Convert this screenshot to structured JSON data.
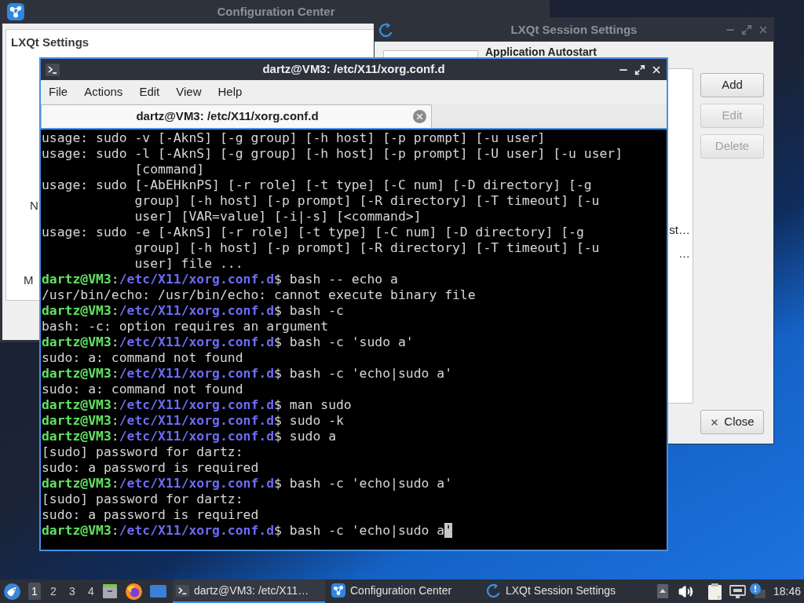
{
  "config_center": {
    "title": "Configuration Center",
    "active": false,
    "panel_title": "LXQt Settings",
    "item_labels": [
      "N",
      "M"
    ]
  },
  "session_settings": {
    "title": "LXQt Session Settings",
    "active": false,
    "section_title": "Application Autostart",
    "list_items": [
      "st…",
      "…"
    ],
    "buttons": [
      {
        "label": "Add",
        "disabled": false
      },
      {
        "label": "Edit",
        "disabled": true
      },
      {
        "label": "Delete",
        "disabled": true
      }
    ],
    "close_button": "Close"
  },
  "terminal": {
    "title": "dartz@VM3: /etc/X11/xorg.conf.d",
    "active": true,
    "menu": [
      "File",
      "Actions",
      "Edit",
      "View",
      "Help"
    ],
    "tabs": [
      {
        "label": "dartz@VM3: /etc/X11/xorg.conf.d",
        "selected": true
      }
    ],
    "lines": [
      {
        "kind": "output",
        "text": "usage: sudo -v [-AknS] [-g group] [-h host] [-p prompt] [-u user]"
      },
      {
        "kind": "output",
        "text": "usage: sudo -l [-AknS] [-g group] [-h host] [-p prompt] [-U user] [-u user]"
      },
      {
        "kind": "wrap",
        "text": "[command]"
      },
      {
        "kind": "output",
        "text": "usage: sudo [-AbEHknPS] [-r role] [-t type] [-C num] [-D directory] [-g"
      },
      {
        "kind": "wrap",
        "text": "group] [-h host] [-p prompt] [-R directory] [-T timeout] [-u"
      },
      {
        "kind": "wrap",
        "text": "user] [VAR=value] [-i|-s] [<command>]"
      },
      {
        "kind": "output",
        "text": "usage: sudo -e [-AknS] [-r role] [-t type] [-C num] [-D directory] [-g"
      },
      {
        "kind": "wrap",
        "text": "group] [-h host] [-p prompt] [-R directory] [-T timeout] [-u"
      },
      {
        "kind": "wrap",
        "text": "user] file ..."
      },
      {
        "kind": "prompt",
        "user": "dartz@VM3",
        "sep": ":",
        "path": "/etc/X11/xorg.conf.d",
        "command": "$ bash -- echo a"
      },
      {
        "kind": "output",
        "text": "/usr/bin/echo: /usr/bin/echo: cannot execute binary file"
      },
      {
        "kind": "prompt",
        "user": "dartz@VM3",
        "sep": ":",
        "path": "/etc/X11/xorg.conf.d",
        "command": "$ bash -c"
      },
      {
        "kind": "output",
        "text": "bash: -c: option requires an argument"
      },
      {
        "kind": "prompt",
        "user": "dartz@VM3",
        "sep": ":",
        "path": "/etc/X11/xorg.conf.d",
        "command": "$ bash -c 'sudo a'"
      },
      {
        "kind": "output",
        "text": "sudo: a: command not found"
      },
      {
        "kind": "prompt",
        "user": "dartz@VM3",
        "sep": ":",
        "path": "/etc/X11/xorg.conf.d",
        "command": "$ bash -c 'echo|sudo a'"
      },
      {
        "kind": "output",
        "text": "sudo: a: command not found"
      },
      {
        "kind": "prompt",
        "user": "dartz@VM3",
        "sep": ":",
        "path": "/etc/X11/xorg.conf.d",
        "command": "$ man sudo"
      },
      {
        "kind": "prompt",
        "user": "dartz@VM3",
        "sep": ":",
        "path": "/etc/X11/xorg.conf.d",
        "command": "$ sudo -k"
      },
      {
        "kind": "prompt",
        "user": "dartz@VM3",
        "sep": ":",
        "path": "/etc/X11/xorg.conf.d",
        "command": "$ sudo a"
      },
      {
        "kind": "output",
        "text": "[sudo] password for dartz:"
      },
      {
        "kind": "output",
        "text": "sudo: a password is required"
      },
      {
        "kind": "prompt",
        "user": "dartz@VM3",
        "sep": ":",
        "path": "/etc/X11/xorg.conf.d",
        "command": "$ bash -c 'echo|sudo a'"
      },
      {
        "kind": "output",
        "text": "[sudo] password for dartz:"
      },
      {
        "kind": "output",
        "text": "sudo: a password is required"
      },
      {
        "kind": "prompt",
        "user": "dartz@VM3",
        "sep": ":",
        "path": "/etc/X11/xorg.conf.d",
        "command": "$ bash -c 'echo|sudo a",
        "cursor": "'"
      }
    ]
  },
  "taskbar": {
    "workspaces": [
      {
        "label": "1",
        "selected": true
      },
      {
        "label": "2",
        "selected": false
      },
      {
        "label": "3",
        "selected": false
      },
      {
        "label": "4",
        "selected": false
      }
    ],
    "tasks": [
      {
        "kind": "terminal",
        "label": "dartz@VM3: /etc/X11…",
        "selected": true
      },
      {
        "kind": "config",
        "label": "Configuration Center",
        "selected": false
      },
      {
        "kind": "session",
        "label": "LXQt Session Settings",
        "selected": false
      }
    ],
    "clock": "18:46"
  }
}
